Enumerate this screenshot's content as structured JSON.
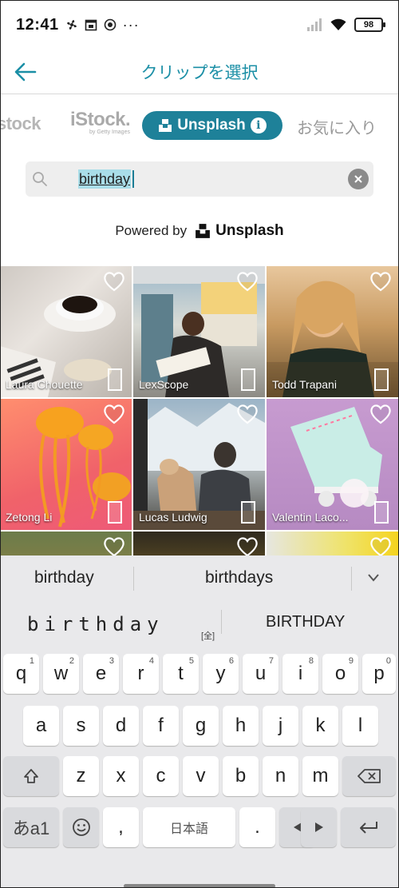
{
  "status_bar": {
    "time": "12:41",
    "battery": "98"
  },
  "header": {
    "title": "クリップを選択"
  },
  "source_tabs": {
    "istock_cut": "stock",
    "istock": "iStock.",
    "istock_sub": "by Getty Images",
    "unsplash": "Unsplash",
    "favorites": "お気に入り"
  },
  "search": {
    "value": "birthday"
  },
  "powered_by": {
    "label": "Powered by",
    "brand": "Unsplash"
  },
  "photos": [
    {
      "credit": "Laura Chouette"
    },
    {
      "credit": "LexScope"
    },
    {
      "credit": "Todd Trapani"
    },
    {
      "credit": "Zetong Li"
    },
    {
      "credit": "Lucas Ludwig"
    },
    {
      "credit": "Valentin Laco..."
    }
  ],
  "keyboard": {
    "suggestions": [
      "birthday",
      "birthdays"
    ],
    "conversion": "birthday",
    "conversion_tag": "[全]",
    "conversion_alt": "BIRTHDAY",
    "row1": [
      "q",
      "w",
      "e",
      "r",
      "t",
      "y",
      "u",
      "i",
      "o",
      "p"
    ],
    "row1_nums": [
      "1",
      "2",
      "3",
      "4",
      "5",
      "6",
      "7",
      "8",
      "9",
      "0"
    ],
    "row2": [
      "a",
      "s",
      "d",
      "f",
      "g",
      "h",
      "j",
      "k",
      "l"
    ],
    "row3": [
      "z",
      "x",
      "c",
      "v",
      "b",
      "n",
      "m"
    ],
    "mode_key": "あa1",
    "comma": ",",
    "space": "日本語",
    "period": "."
  },
  "colors": {
    "accent": "#1e8199",
    "title": "#1b8fa6"
  }
}
